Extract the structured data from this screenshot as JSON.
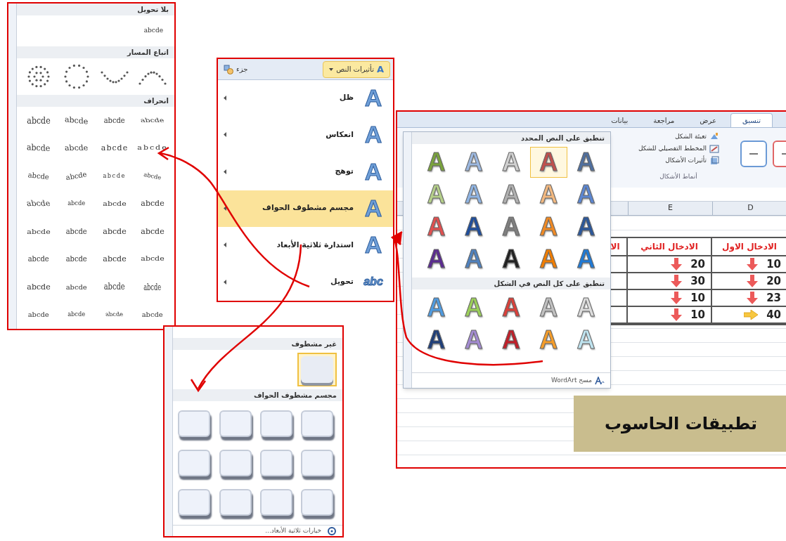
{
  "transform_panel": {
    "no_transform_title": "بلا تحويل",
    "no_transform_sample": "abcde",
    "path_title": "اتباع المسار",
    "path_styles": [
      {
        "kind": "arc-up"
      },
      {
        "kind": "arc-down"
      },
      {
        "kind": "ring"
      },
      {
        "kind": "circle"
      }
    ],
    "warp_title": "انحراف",
    "warp_styles": [
      {
        "label": "abcde"
      },
      {
        "label": "abcde"
      },
      {
        "label": "abcde"
      },
      {
        "label": "abcde"
      },
      {
        "label": "abcde"
      },
      {
        "label": "abcde"
      },
      {
        "label": "abcde"
      },
      {
        "label": "abcde"
      },
      {
        "label": "abcde"
      },
      {
        "label": "abcde"
      },
      {
        "label": "abcde"
      },
      {
        "label": "abcde"
      },
      {
        "label": "abcde"
      },
      {
        "label": "abcde"
      },
      {
        "label": "abcde"
      },
      {
        "label": "abcde"
      },
      {
        "label": "abcde"
      },
      {
        "label": "abcde"
      },
      {
        "label": "abcde"
      },
      {
        "label": "abcde"
      },
      {
        "label": "abcde"
      },
      {
        "label": "abcde"
      },
      {
        "label": "abcde"
      },
      {
        "label": "abcde"
      },
      {
        "label": "abcde"
      },
      {
        "label": "abcde"
      },
      {
        "label": "abcde"
      },
      {
        "label": "abcde"
      },
      {
        "label": "abcde"
      },
      {
        "label": "abcde"
      },
      {
        "label": "abcde"
      },
      {
        "label": "abcde"
      }
    ]
  },
  "effects_menu": {
    "button": {
      "label": "تأثيرات النص",
      "glyph": "A"
    },
    "side_label": "جزء",
    "items": [
      {
        "label": "ظل",
        "glyph": "A",
        "selected": false
      },
      {
        "label": "انعكاس",
        "glyph": "A",
        "selected": false
      },
      {
        "label": "توهج",
        "glyph": "A",
        "selected": false
      },
      {
        "label": "مجسم مشطوف الحواف",
        "glyph": "A",
        "selected": true
      },
      {
        "label": "استدارة ثلاثية الأبعاد",
        "glyph": "A",
        "selected": false
      },
      {
        "label": "تحويل",
        "glyph": "abc",
        "selected": false
      }
    ]
  },
  "excel": {
    "tabs": [
      {
        "label": "تنسيق",
        "selected": true
      },
      {
        "label": "عرض",
        "selected": false
      },
      {
        "label": "مراجعة",
        "selected": false
      },
      {
        "label": "بيانات",
        "selected": false
      }
    ],
    "shape_commands": [
      "تعبئة الشكل",
      "المخطط التفصيلي للشكل",
      "تأثيرات الأشكال"
    ],
    "group_label": "أنماط الأشكال",
    "wordart_gallery": {
      "sections": [
        {
          "title": "تنطبق على النص المحدد",
          "swatches": [
            {
              "label": "A",
              "color": "#4f6f9f",
              "selected": false
            },
            {
              "label": "A",
              "color": "#c0504d",
              "selected": true
            },
            {
              "label": "A",
              "color": "#d0d0d0",
              "selected": false
            },
            {
              "label": "A",
              "color": "#9cb8e0",
              "selected": false
            },
            {
              "label": "A",
              "color": "#7aa33c",
              "selected": false
            },
            {
              "label": "A",
              "color": "#5b86d1",
              "selected": false
            },
            {
              "label": "A",
              "color": "#f2b880",
              "selected": false
            },
            {
              "label": "A",
              "color": "#b0b0b0",
              "selected": false
            },
            {
              "label": "A",
              "color": "#8fb4e3",
              "selected": false
            },
            {
              "label": "A",
              "color": "#b5cf8a",
              "selected": false
            },
            {
              "label": "A",
              "color": "#2b579a",
              "selected": false
            },
            {
              "label": "A",
              "color": "#f08a24",
              "selected": false
            },
            {
              "label": "A",
              "color": "#7f7f7f",
              "selected": false
            },
            {
              "label": "A",
              "color": "#1f4e9c",
              "selected": false
            },
            {
              "label": "A",
              "color": "#e05050",
              "selected": false
            },
            {
              "label": "A",
              "color": "#1f7ad6",
              "selected": false
            },
            {
              "label": "A",
              "color": "#f07d00",
              "selected": false
            },
            {
              "label": "A",
              "color": "#222222",
              "selected": false
            },
            {
              "label": "A",
              "color": "#4f81bd",
              "selected": false
            },
            {
              "label": "A",
              "color": "#5b2c91",
              "selected": false
            }
          ]
        },
        {
          "title": "تنطبق على كل النص في الشكل",
          "swatches": [
            {
              "label": "A",
              "color": "#dcdcdc",
              "selected": false
            },
            {
              "label": "A",
              "color": "#c0c0c0",
              "selected": false
            },
            {
              "label": "A",
              "color": "#d9403a",
              "selected": false
            },
            {
              "label": "A",
              "color": "#9bcf5a",
              "selected": false
            },
            {
              "label": "A",
              "color": "#4f9be0",
              "selected": false
            },
            {
              "label": "A",
              "color": "#bfe3ef",
              "selected": false
            },
            {
              "label": "A",
              "color": "#f59d2a",
              "selected": false
            },
            {
              "label": "A",
              "color": "#c0202a",
              "selected": false
            },
            {
              "label": "A",
              "color": "#a38bd1",
              "selected": false
            },
            {
              "label": "A",
              "color": "#1f3f7a",
              "selected": false
            }
          ]
        }
      ],
      "clear_label": "مسح WordArt"
    },
    "columns": [
      "D",
      "E"
    ],
    "table": {
      "headers": [
        "الادخال الاول",
        "الادخال الثاني",
        "الا"
      ],
      "rows": [
        {
          "cells": [
            {
              "value": "10",
              "kind": "down"
            },
            {
              "value": "20",
              "kind": "down"
            }
          ]
        },
        {
          "cells": [
            {
              "value": "20",
              "kind": "down"
            },
            {
              "value": "30",
              "kind": "down"
            }
          ]
        },
        {
          "cells": [
            {
              "value": "23",
              "kind": "down"
            },
            {
              "value": "10",
              "kind": "down"
            }
          ]
        },
        {
          "cells": [
            {
              "value": "40",
              "kind": "right"
            },
            {
              "value": "10",
              "kind": "down"
            }
          ]
        }
      ]
    },
    "title_box": "تطبيقات الحاسوب"
  },
  "bevel_panel": {
    "sections": [
      {
        "title": "غير مشطوف",
        "items": [
          {
            "kind": "flat",
            "selected": true
          }
        ]
      },
      {
        "title": "مجسم مشطوف الحواف",
        "items": [
          {
            "kind": "bevel",
            "selected": false
          },
          {
            "kind": "bevel",
            "selected": false
          },
          {
            "kind": "bevel",
            "selected": false
          },
          {
            "kind": "bevel",
            "selected": false
          },
          {
            "kind": "bevel",
            "selected": false
          },
          {
            "kind": "bevel",
            "selected": false
          },
          {
            "kind": "bevel",
            "selected": false
          },
          {
            "kind": "bevel",
            "selected": false
          },
          {
            "kind": "bevel",
            "selected": false
          },
          {
            "kind": "bevel",
            "selected": false
          },
          {
            "kind": "bevel",
            "selected": false
          },
          {
            "kind": "bevel",
            "selected": false
          }
        ]
      }
    ],
    "options_label": "خيارات ثلاثية الأبعاد..."
  }
}
